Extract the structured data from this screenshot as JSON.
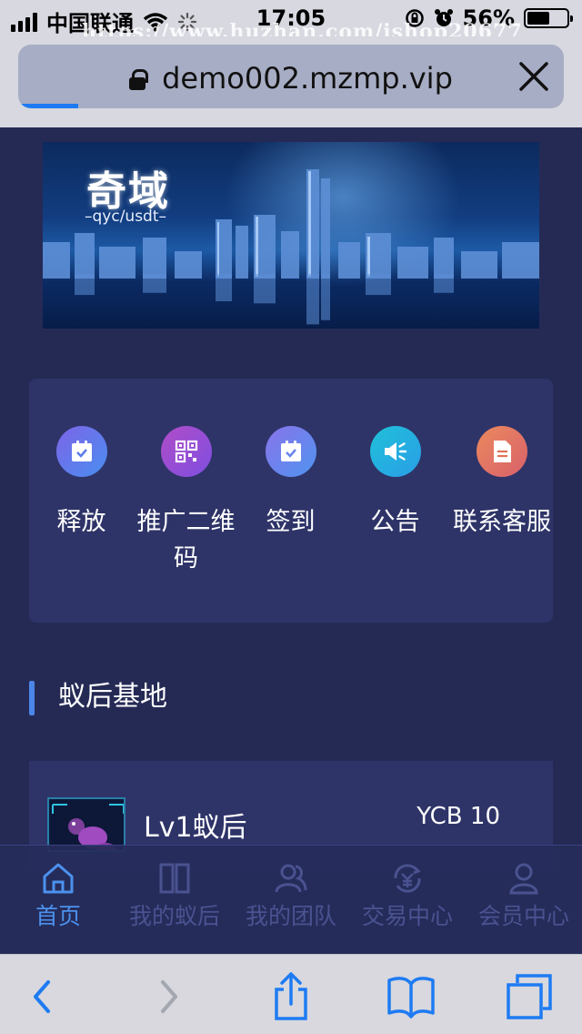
{
  "status_bar": {
    "carrier": "中国联通",
    "time": "17:05",
    "battery": "56%",
    "battery_level": 0.56,
    "watermark": "https://www.huzhan.com/ishop20677"
  },
  "browser": {
    "url": "demo002.mzmp.vip",
    "load_progress": 0.11
  },
  "banner": {
    "logo_text": "奇域",
    "sub_text": "–qyc/usdt–"
  },
  "menu": {
    "items": [
      {
        "label": "释放",
        "icon": "calendar-check-icon",
        "color": "#5d7bea"
      },
      {
        "label": "推广二维码",
        "icon": "qrcode-icon",
        "color": "#a04bd0"
      },
      {
        "label": "签到",
        "icon": "calendar-check-icon",
        "color": "#6a86ec"
      },
      {
        "label": "公告",
        "icon": "megaphone-icon",
        "color": "#27b5e6"
      },
      {
        "label": "联系客服",
        "icon": "document-icon",
        "color": "#e0705a"
      }
    ]
  },
  "section": {
    "title": "蚁后基地"
  },
  "product": {
    "name": "Lv1蚁后",
    "price": "YCB 10"
  },
  "tabs": [
    {
      "label": "首页",
      "icon": "home-icon",
      "active": true
    },
    {
      "label": "我的蚁后",
      "icon": "book-icon",
      "active": false
    },
    {
      "label": "我的团队",
      "icon": "team-icon",
      "active": false
    },
    {
      "label": "交易中心",
      "icon": "exchange-icon",
      "active": false
    },
    {
      "label": "会员中心",
      "icon": "user-icon",
      "active": false
    }
  ],
  "colors": {
    "background": "#252a55",
    "card": "#2e3468",
    "accent": "#4c91ee",
    "inactive": "#4a5290"
  }
}
